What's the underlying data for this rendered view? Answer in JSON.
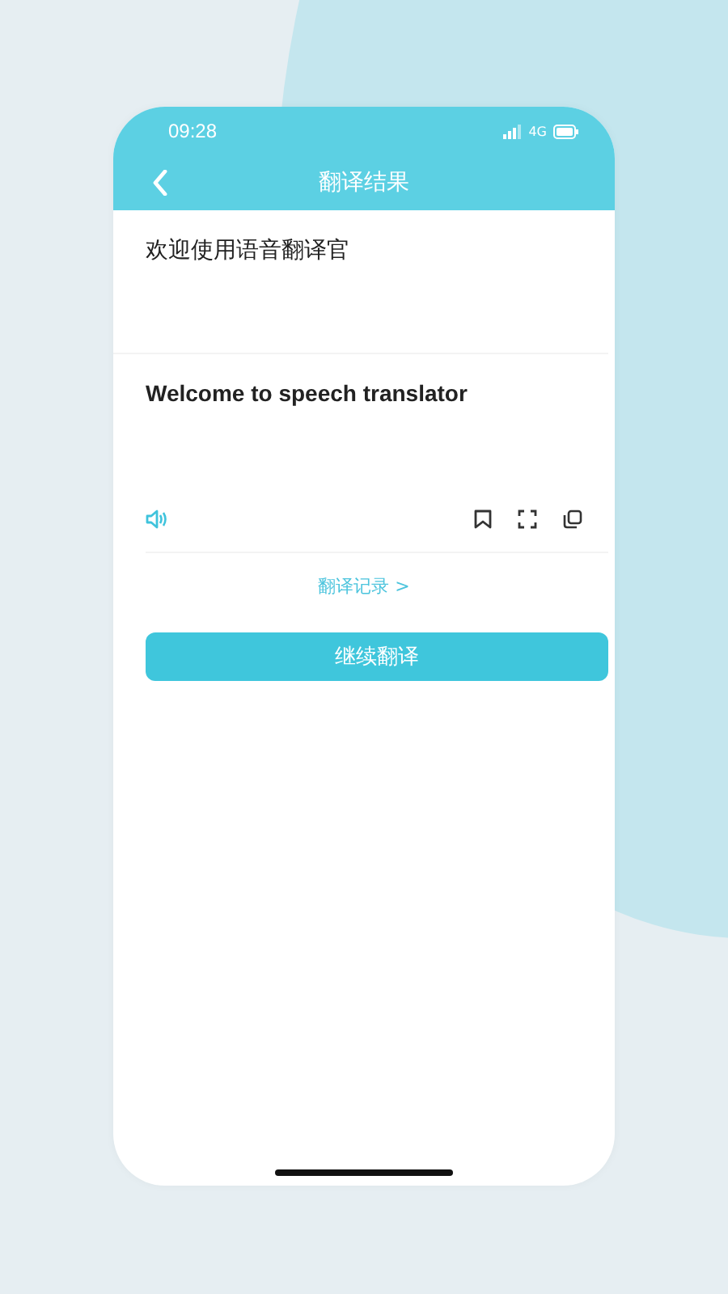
{
  "status_bar": {
    "time": "09:28",
    "network": "4G"
  },
  "header": {
    "title": "翻译结果"
  },
  "source_text": "欢迎使用语音翻译官",
  "translated_text": "Welcome to speech translator",
  "history_link": "翻译记录 >",
  "continue_button": "继续翻译"
}
